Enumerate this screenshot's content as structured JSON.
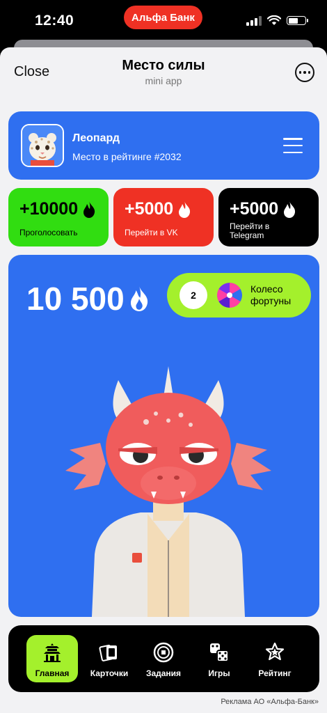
{
  "status": {
    "time": "12:40",
    "bank_label": "Альфа Банк"
  },
  "nav": {
    "close_label": "Close",
    "title": "Место силы",
    "subtitle": "mini app"
  },
  "profile": {
    "name": "Леопард",
    "rank": "Место в рейтинге #2032"
  },
  "rewards": [
    {
      "amount": "+10000",
      "label": "Проголосовать",
      "color": "#31dd11"
    },
    {
      "amount": "+5000",
      "label": "Перейти в VK",
      "color": "#ef3124"
    },
    {
      "amount": "+5000",
      "label": "Перейти в Telegram",
      "color": "#000000"
    }
  ],
  "balance": {
    "value": "10 500"
  },
  "wheel": {
    "count": "2",
    "label": "Колесо фортуны"
  },
  "tabs": [
    {
      "label": "Главная",
      "icon": "pagoda-icon",
      "active": true
    },
    {
      "label": "Карточки",
      "icon": "cards-icon",
      "active": false
    },
    {
      "label": "Задания",
      "icon": "coin-icon",
      "active": false
    },
    {
      "label": "Игры",
      "icon": "dice-icon",
      "active": false
    },
    {
      "label": "Рейтинг",
      "icon": "star-badge-icon",
      "active": false
    }
  ],
  "footer": {
    "ad_note": "Реклама АО «Альфа-Банк»"
  },
  "colors": {
    "accent_blue": "#2f6ff0",
    "lime": "#a4f02c",
    "alfa_red": "#ef3124",
    "green": "#31dd11"
  }
}
